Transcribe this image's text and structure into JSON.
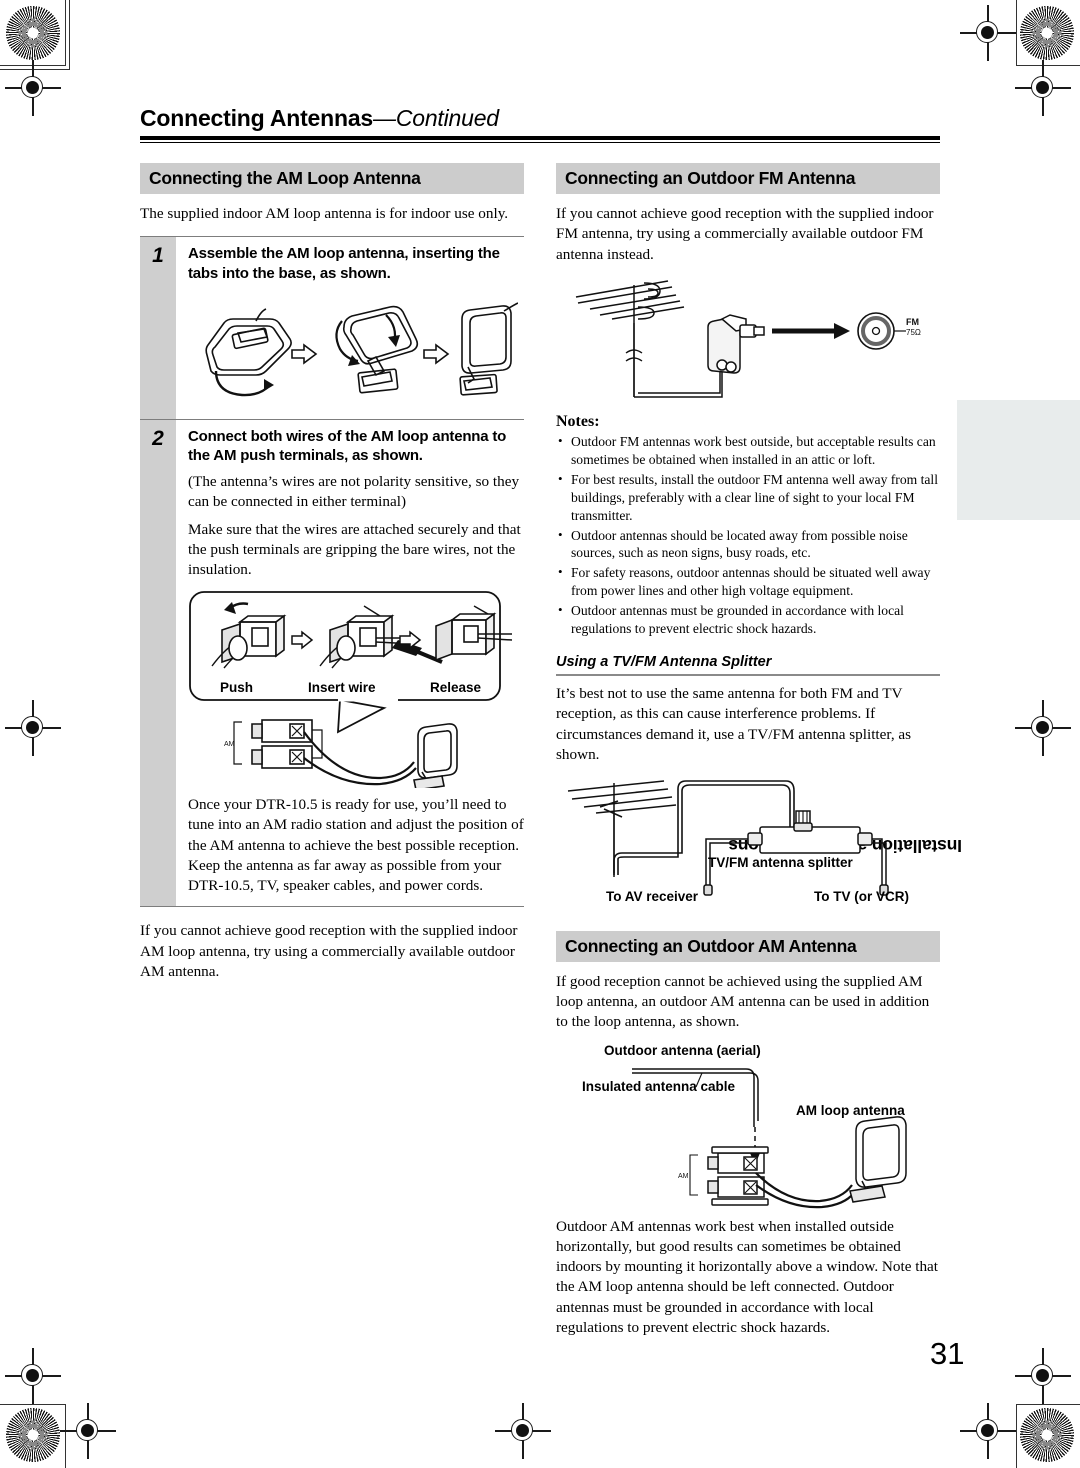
{
  "document": {
    "running_head_main": "Connecting Antennas",
    "running_head_cont": "—Continued",
    "page_number": "31",
    "edge_tab_label": "Installation and Connections"
  },
  "left_column": {
    "section_heading": "Connecting the AM Loop Antenna",
    "intro": "The supplied indoor AM loop antenna is for indoor use only.",
    "steps": [
      {
        "number": "1",
        "title": "Assemble the AM loop antenna, inserting the tabs into the base, as shown.",
        "figure_name": "am-loop-assembly-figure"
      },
      {
        "number": "2",
        "title": "Connect both wires of the AM loop antenna to the AM push terminals, as shown.",
        "paragraphs": [
          "(The antenna’s wires are not polarity sensitive, so they can be connected in either terminal)",
          "Make sure that the wires are attached securely and that the push terminals are gripping the bare wires, not the insulation."
        ],
        "figure_name": "am-push-terminal-figure",
        "figure_captions": [
          "Push",
          "Insert wire",
          "Release"
        ],
        "terminal_label": "AM",
        "closing": "Once your DTR-10.5 is ready for use, you’ll need to tune into an AM radio station and adjust the position of the AM antenna to achieve the best possible reception. Keep the antenna as far away as possible from your DTR-10.5, TV, speaker cables, and power cords."
      }
    ],
    "outro": "If you cannot achieve good reception with the supplied indoor AM loop antenna, try using a commercially available outdoor AM antenna."
  },
  "right_column": {
    "fm_section": {
      "heading": "Connecting an Outdoor FM Antenna",
      "intro": "If you cannot achieve good reception with the supplied indoor FM antenna, try using a commercially available outdoor FM antenna instead.",
      "figure_name": "outdoor-fm-antenna-figure",
      "jack_label_line1": "FM",
      "jack_label_line2": "75Ω",
      "notes_label": "Notes:",
      "notes": [
        "Outdoor FM antennas work best outside, but acceptable results can sometimes be obtained when installed in an attic or loft.",
        "For best results, install the outdoor FM antenna well away from tall buildings, preferably with a clear line of sight to your local FM transmitter.",
        "Outdoor antennas should be located away from possible noise sources, such as neon signs, busy roads, etc.",
        "For safety reasons, outdoor antennas should be situated well away from power lines and other high voltage equipment.",
        "Outdoor antennas must be grounded in accordance with local regulations to prevent electric shock hazards."
      ]
    },
    "splitter_section": {
      "subheading": "Using a TV/FM Antenna Splitter",
      "body": "It’s best not to use the same antenna for both FM and TV reception, as this can cause interference problems. If circumstances demand it, use a TV/FM antenna splitter, as shown.",
      "figure_name": "tv-fm-splitter-figure",
      "labels": {
        "splitter": "TV/FM antenna splitter",
        "to_av_receiver": "To AV receiver",
        "to_tv": "To TV (or VCR)"
      }
    },
    "am_section": {
      "heading": "Connecting an Outdoor AM Antenna",
      "intro": "If good reception cannot be achieved using the supplied AM loop antenna, an outdoor AM antenna can be used in addition to the loop antenna, as shown.",
      "figure_name": "outdoor-am-antenna-figure",
      "labels": {
        "aerial": "Outdoor antenna (aerial)",
        "cable": "Insulated antenna cable",
        "loop": "AM loop antenna",
        "terminal": "AM"
      },
      "outro": "Outdoor AM antennas work best when installed outside horizontally, but good results can sometimes be obtained indoors by mounting it horizontally above a window. Note that the AM loop antenna should be left connected. Outdoor antennas must be grounded in accordance with local regulations to prevent electric shock hazards."
    }
  }
}
